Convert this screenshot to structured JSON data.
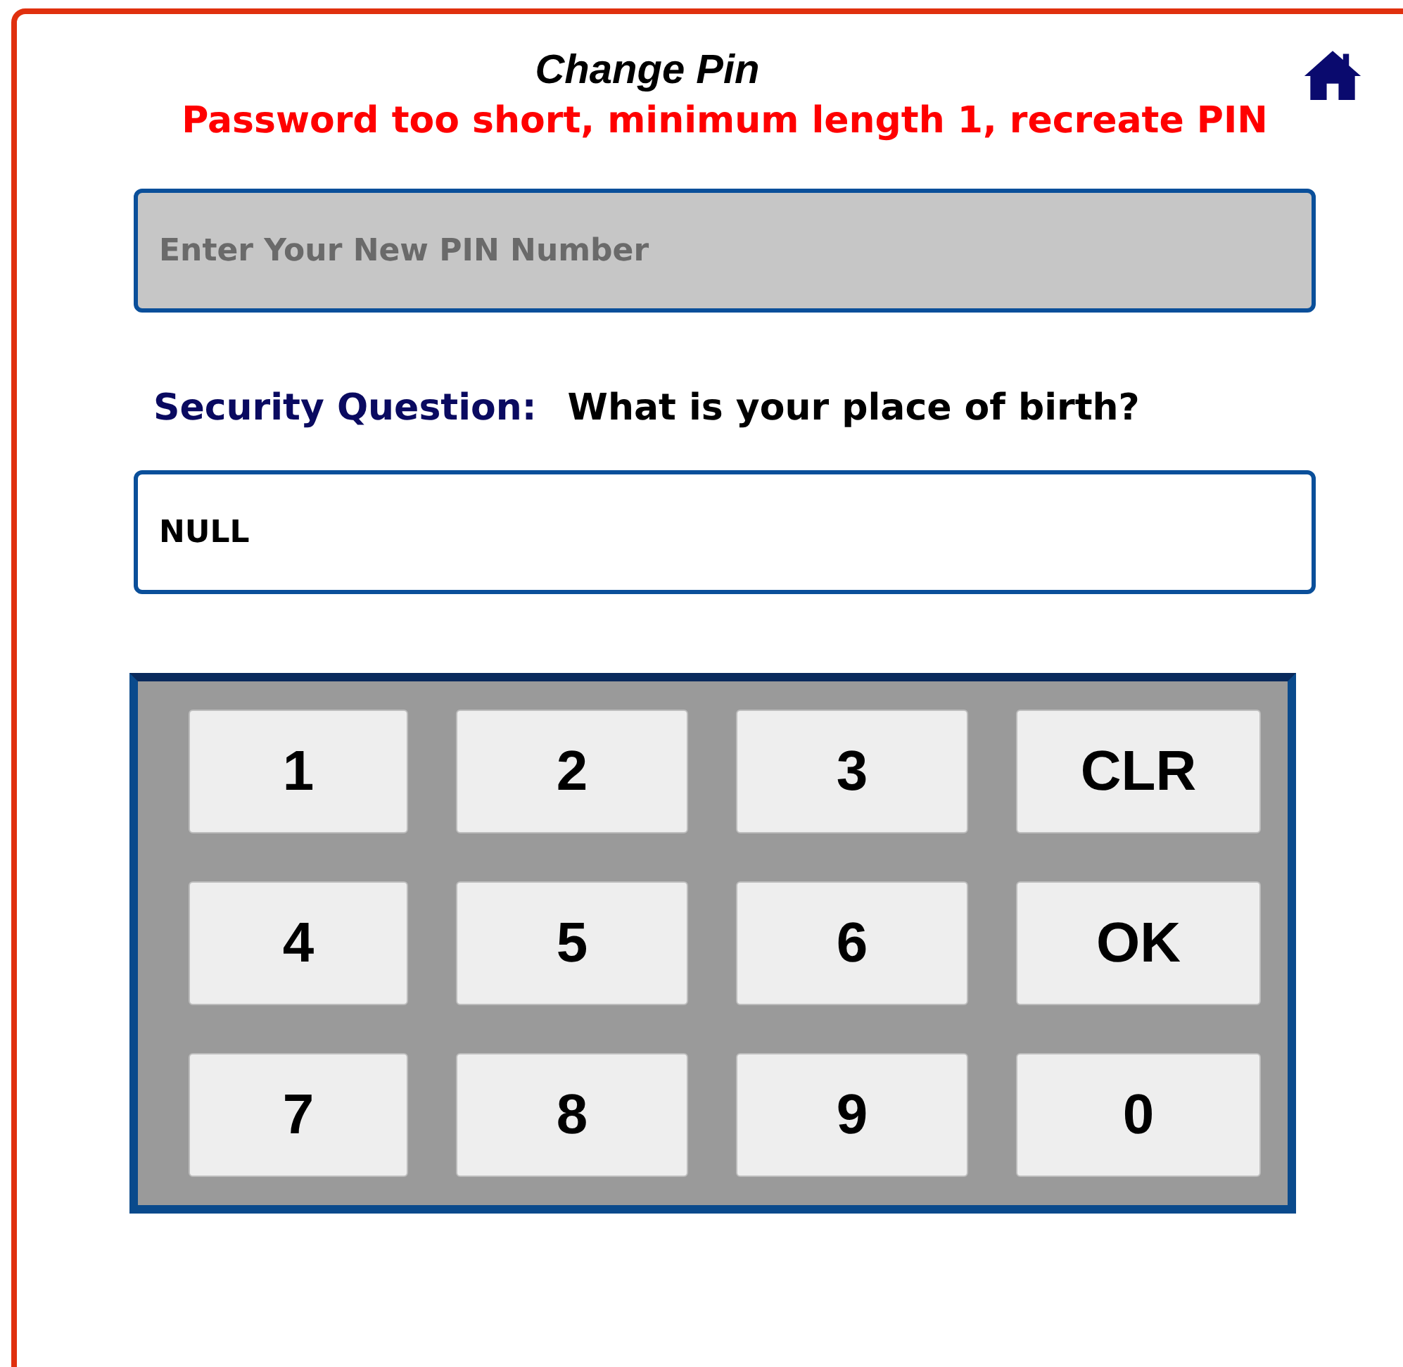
{
  "header": {
    "title": "Change Pin"
  },
  "error_message": "Password too short, minimum length 1, recreate PIN",
  "pin_field": {
    "placeholder": "Enter Your New PIN Number",
    "disabled": true
  },
  "security_question": {
    "label": "Security Question:",
    "question": "What is your place of birth?"
  },
  "answer_field": {
    "value": "NULL",
    "disabled": false
  },
  "keypad": {
    "keys": [
      "1",
      "2",
      "3",
      "CLR",
      "4",
      "5",
      "6",
      "OK",
      "7",
      "8",
      "9",
      "0"
    ]
  }
}
